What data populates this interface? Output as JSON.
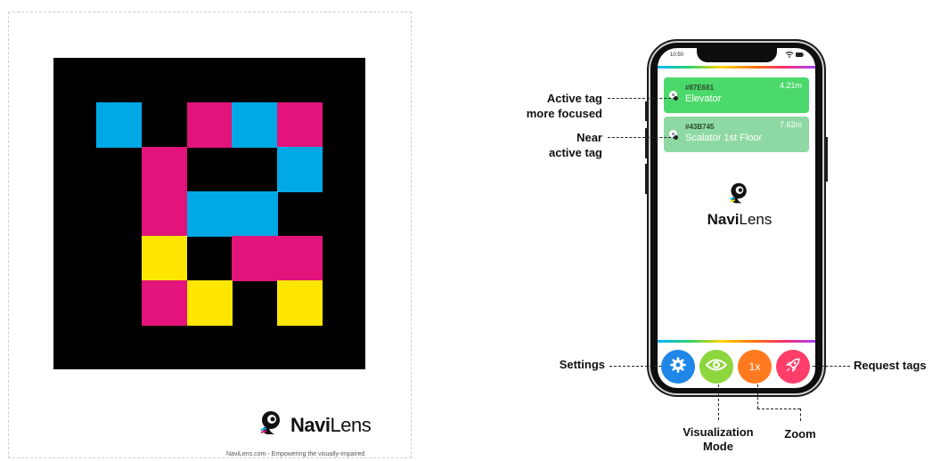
{
  "left_card": {
    "code_colors": {
      "cyan": "#00a9e6",
      "magenta": "#e2137a",
      "yellow": "#ffe600",
      "background": "#000000"
    },
    "brand": {
      "name_bold": "Navi",
      "name_light": "Lens",
      "icon": "navilens-mascot-icon"
    },
    "tagline": "NaviLens.com - Empowering the visually-impaired"
  },
  "phone": {
    "status_time": "10:50",
    "status_icons": "wifi-icon battery-icon",
    "tags": [
      {
        "id": "#87E681",
        "distance": "4.21m",
        "name": "Elevator",
        "state": "active",
        "color": "#4cd96b"
      },
      {
        "id": "#43B745",
        "distance": "7.62m",
        "name": "Scalator 1st Floor",
        "state": "near",
        "color": "#8ed9a3"
      }
    ],
    "app_brand": {
      "bold": "Navi",
      "light": "Lens"
    },
    "buttons": {
      "settings": {
        "icon": "gear-icon",
        "color": "#1f87e8"
      },
      "visualization": {
        "icon": "eye-icon",
        "color": "#8dd63d"
      },
      "zoom": {
        "label": "1x",
        "color": "#ff7a1f"
      },
      "request": {
        "icon": "rocket-icon",
        "color": "#ff3d6b"
      }
    }
  },
  "annotations": {
    "active_tag": [
      "Active tag",
      "more focused"
    ],
    "near_tag": [
      "Near",
      "active tag"
    ],
    "settings": "Settings",
    "visualization": [
      "Visualization",
      "Mode"
    ],
    "zoom": "Zoom",
    "request": "Request tags"
  }
}
